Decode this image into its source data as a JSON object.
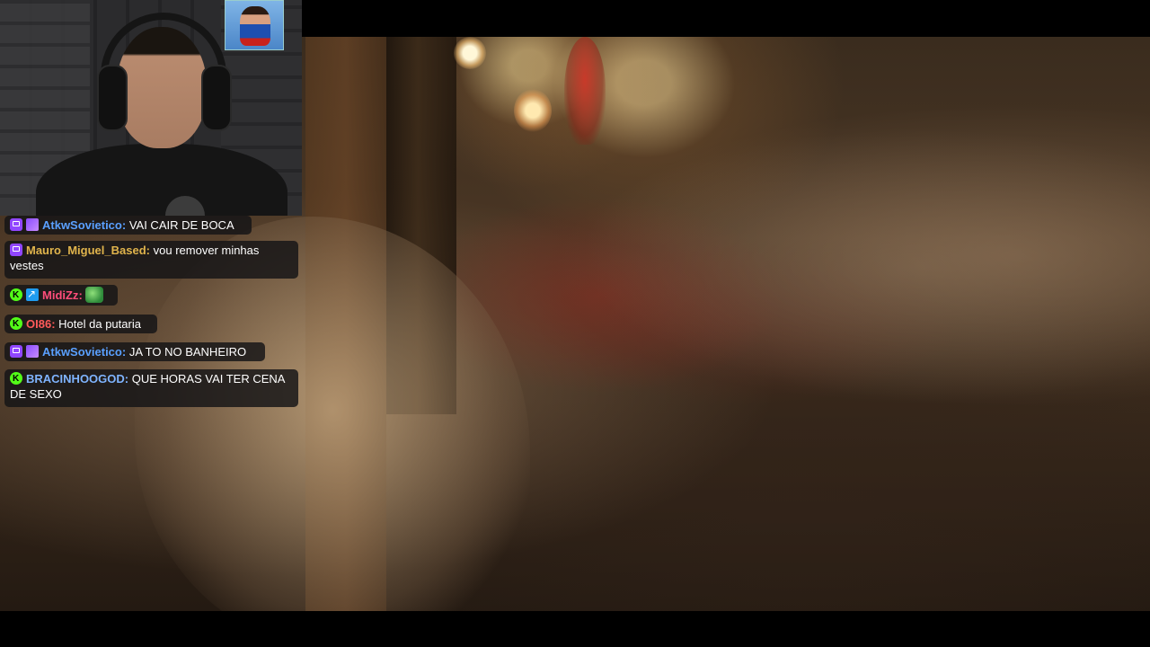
{
  "chat": {
    "messages": [
      {
        "badges": [
          "twitch-icon",
          "sub-badge-icon"
        ],
        "user": "AtkwSovietico",
        "user_color": "#5aa0ff",
        "text": "VAI CAIR DE BOCA"
      },
      {
        "badges": [
          "twitch-icon"
        ],
        "user": "Mauro_Miguel_Based",
        "user_color": "#e0b44c",
        "text": "vou remover minhas vestes"
      },
      {
        "badges": [
          "kick-icon",
          "arrow-badge-icon"
        ],
        "user": "MidiZz",
        "user_color": "#ff4d7a",
        "text": "",
        "emote": "frog-emote-icon"
      },
      {
        "badges": [
          "kick-icon"
        ],
        "user": "OI86",
        "user_color": "#ff5a5a",
        "text": "Hotel da putaria"
      },
      {
        "badges": [
          "twitch-icon",
          "sub-badge-icon"
        ],
        "user": "AtkwSovietico",
        "user_color": "#5aa0ff",
        "text": "JA TO NO BANHEIRO"
      },
      {
        "badges": [
          "kick-icon"
        ],
        "user": "BRACINHOOGOD",
        "user_color": "#7fb4ff",
        "text": "QUE HORAS VAI TER CENA DE SEXO"
      }
    ]
  },
  "colors": {
    "twitch": "#9146ff",
    "kick": "#53fc18",
    "chat_bg": "#141416"
  }
}
